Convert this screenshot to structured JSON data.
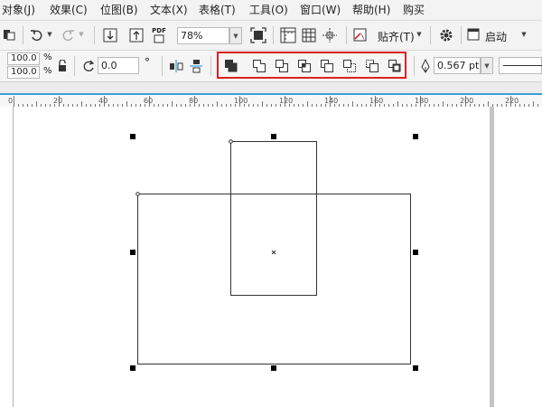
{
  "menu": [
    "对象(J)",
    "效果(C)",
    "位图(B)",
    "文本(X)",
    "表格(T)",
    "工具(O)",
    "窗口(W)",
    "帮助(H)",
    "购买"
  ],
  "toolbar": {
    "zoom_value": "78%",
    "snap_label": "贴齐(T)",
    "launch_label": "启动",
    "pdf_label": "PDF"
  },
  "property_bar": {
    "scale_x": "100.0",
    "scale_y": "100.0",
    "percent_x": "%",
    "percent_y": "%",
    "rotation": "0.0",
    "degree": "°",
    "outline_width": "0.567 pt"
  },
  "shaping_tools": [
    "weld",
    "trim",
    "intersect",
    "simplify",
    "front-minus-back",
    "back-minus-front",
    "create-boundary",
    "create-new-object"
  ],
  "ruler": {
    "labels": [
      "0",
      "20",
      "40",
      "60",
      "80",
      "100",
      "120",
      "140",
      "160",
      "180",
      "200",
      "220"
    ]
  },
  "colors": {
    "highlight_box": "#e02020",
    "ruler_accent": "#3aa0d8"
  }
}
